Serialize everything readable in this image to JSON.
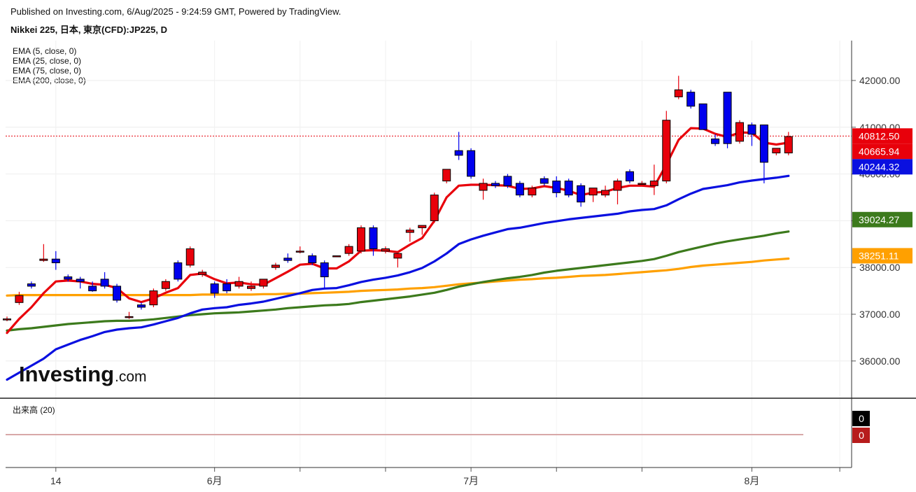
{
  "header": {
    "published": "Published on Investing.com, 6/Aug/2025 - 9:24:59 GMT, Powered by TradingView.",
    "symbol": "Nikkei 225, 日本, 東京(CFD):JP225, D"
  },
  "indicators": {
    "ema5": "EMA (5, close, 0)",
    "ema25": "EMA (25, close, 0)",
    "ema75": "EMA (75, close, 0)",
    "ema200": "EMA (200, close, 0)"
  },
  "volume_label": "出来高 (20)",
  "logo": {
    "main": "Investing",
    "suffix": ".com"
  },
  "colors": {
    "up": "#e8000b",
    "down": "#0000ee",
    "ema5": "#e8000b",
    "ema25": "#0a10e0",
    "ema75": "#3c7a1c",
    "ema200": "#ffa000",
    "last_price_line": "#e8000b"
  },
  "chart_data": {
    "type": "candlestick",
    "y_axis": {
      "ticks": [
        36000,
        37000,
        38000,
        39000,
        40000,
        41000,
        42000
      ],
      "tick_labels": [
        "36000.00",
        "37000.00",
        "38000.00",
        "39000.00",
        "40000.00",
        "41000.00",
        "42000.00"
      ],
      "range": [
        35300,
        42850
      ]
    },
    "x_axis": {
      "tick_labels": [
        {
          "label": "14",
          "index": 4
        },
        {
          "label": "6月",
          "index": 17
        },
        {
          "label": "7月",
          "index": 38
        },
        {
          "label": "8月",
          "index": 61
        }
      ]
    },
    "candles": [
      {
        "o": 36900,
        "h": 36950,
        "l": 36850,
        "c": 36900
      },
      {
        "o": 37250,
        "h": 37480,
        "l": 37200,
        "c": 37400
      },
      {
        "o": 37650,
        "h": 37700,
        "l": 37550,
        "c": 37600
      },
      {
        "o": 38150,
        "h": 38500,
        "l": 38120,
        "c": 38180
      },
      {
        "o": 38180,
        "h": 38350,
        "l": 37950,
        "c": 38100
      },
      {
        "o": 37800,
        "h": 37850,
        "l": 37700,
        "c": 37750
      },
      {
        "o": 37750,
        "h": 37800,
        "l": 37550,
        "c": 37700
      },
      {
        "o": 37600,
        "h": 37700,
        "l": 37480,
        "c": 37500
      },
      {
        "o": 37750,
        "h": 37900,
        "l": 37550,
        "c": 37600
      },
      {
        "o": 37600,
        "h": 37650,
        "l": 37250,
        "c": 37300
      },
      {
        "o": 36950,
        "h": 37050,
        "l": 36900,
        "c": 36950
      },
      {
        "o": 37200,
        "h": 37250,
        "l": 37100,
        "c": 37150
      },
      {
        "o": 37200,
        "h": 37550,
        "l": 37150,
        "c": 37500
      },
      {
        "o": 37550,
        "h": 37750,
        "l": 37500,
        "c": 37700
      },
      {
        "o": 38100,
        "h": 38150,
        "l": 37700,
        "c": 37750
      },
      {
        "o": 38050,
        "h": 38450,
        "l": 38000,
        "c": 38400
      },
      {
        "o": 37850,
        "h": 37950,
        "l": 37800,
        "c": 37900
      },
      {
        "o": 37650,
        "h": 37700,
        "l": 37350,
        "c": 37450
      },
      {
        "o": 37650,
        "h": 37750,
        "l": 37450,
        "c": 37500
      },
      {
        "o": 37600,
        "h": 37800,
        "l": 37550,
        "c": 37700
      },
      {
        "o": 37550,
        "h": 37700,
        "l": 37500,
        "c": 37600
      },
      {
        "o": 37600,
        "h": 37700,
        "l": 37550,
        "c": 37750
      },
      {
        "o": 38000,
        "h": 38100,
        "l": 37950,
        "c": 38050
      },
      {
        "o": 38200,
        "h": 38300,
        "l": 38100,
        "c": 38150
      },
      {
        "o": 38350,
        "h": 38450,
        "l": 38300,
        "c": 38350
      },
      {
        "o": 38250,
        "h": 38300,
        "l": 38050,
        "c": 38100
      },
      {
        "o": 38100,
        "h": 38150,
        "l": 37550,
        "c": 37800
      },
      {
        "o": 38250,
        "h": 38250,
        "l": 38250,
        "c": 38250
      },
      {
        "o": 38300,
        "h": 38500,
        "l": 38250,
        "c": 38450
      },
      {
        "o": 38350,
        "h": 38900,
        "l": 38300,
        "c": 38850
      },
      {
        "o": 38850,
        "h": 38900,
        "l": 38250,
        "c": 38400
      },
      {
        "o": 38350,
        "h": 38450,
        "l": 38300,
        "c": 38400
      },
      {
        "o": 38200,
        "h": 38300,
        "l": 38000,
        "c": 38300
      },
      {
        "o": 38750,
        "h": 38850,
        "l": 38550,
        "c": 38800
      },
      {
        "o": 38850,
        "h": 38900,
        "l": 38700,
        "c": 38900
      },
      {
        "o": 39000,
        "h": 39600,
        "l": 38950,
        "c": 39550
      },
      {
        "o": 39850,
        "h": 40000,
        "l": 39800,
        "c": 40100
      },
      {
        "o": 40500,
        "h": 40900,
        "l": 40300,
        "c": 40400
      },
      {
        "o": 40500,
        "h": 40550,
        "l": 39900,
        "c": 39950
      },
      {
        "o": 39650,
        "h": 39900,
        "l": 39450,
        "c": 39800
      },
      {
        "o": 39800,
        "h": 39850,
        "l": 39700,
        "c": 39750
      },
      {
        "o": 39950,
        "h": 40000,
        "l": 39700,
        "c": 39750
      },
      {
        "o": 39800,
        "h": 39850,
        "l": 39500,
        "c": 39550
      },
      {
        "o": 39550,
        "h": 39750,
        "l": 39500,
        "c": 39700
      },
      {
        "o": 39900,
        "h": 39950,
        "l": 39750,
        "c": 39800
      },
      {
        "o": 39850,
        "h": 39950,
        "l": 39500,
        "c": 39600
      },
      {
        "o": 39850,
        "h": 39900,
        "l": 39500,
        "c": 39550
      },
      {
        "o": 39750,
        "h": 39800,
        "l": 39300,
        "c": 39400
      },
      {
        "o": 39550,
        "h": 39650,
        "l": 39400,
        "c": 39700
      },
      {
        "o": 39550,
        "h": 39750,
        "l": 39500,
        "c": 39650
      },
      {
        "o": 39650,
        "h": 39900,
        "l": 39350,
        "c": 39850
      },
      {
        "o": 40050,
        "h": 40100,
        "l": 39800,
        "c": 39850
      },
      {
        "o": 39800,
        "h": 39850,
        "l": 39750,
        "c": 39800
      },
      {
        "o": 39750,
        "h": 40200,
        "l": 39550,
        "c": 39850
      },
      {
        "o": 39850,
        "h": 41350,
        "l": 39800,
        "c": 41150
      },
      {
        "o": 41650,
        "h": 42100,
        "l": 41600,
        "c": 41800
      },
      {
        "o": 41750,
        "h": 41800,
        "l": 41400,
        "c": 41450
      },
      {
        "o": 41500,
        "h": 41500,
        "l": 40950,
        "c": 40950
      },
      {
        "o": 40750,
        "h": 40850,
        "l": 40600,
        "c": 40650
      },
      {
        "o": 41750,
        "h": 41750,
        "l": 40550,
        "c": 40650
      },
      {
        "o": 40700,
        "h": 41150,
        "l": 40650,
        "c": 41100
      },
      {
        "o": 41050,
        "h": 41100,
        "l": 40600,
        "c": 40850
      },
      {
        "o": 41050,
        "h": 41050,
        "l": 39800,
        "c": 40250
      },
      {
        "o": 40450,
        "h": 40550,
        "l": 40400,
        "c": 40550
      },
      {
        "o": 40450,
        "h": 40900,
        "l": 40400,
        "c": 40800
      }
    ],
    "series": [
      {
        "name": "EMA (5, close, 0)",
        "last": 40665.94,
        "values": [
          36600,
          36900,
          37150,
          37450,
          37700,
          37720,
          37700,
          37650,
          37630,
          37560,
          37340,
          37260,
          37340,
          37460,
          37560,
          37840,
          37870,
          37750,
          37660,
          37680,
          37640,
          37630,
          37770,
          37910,
          38060,
          38080,
          37980,
          37980,
          38130,
          38360,
          38370,
          38360,
          38330,
          38490,
          38630,
          39000,
          39500,
          39750,
          39770,
          39770,
          39760,
          39750,
          39680,
          39690,
          39740,
          39700,
          39640,
          39550,
          39600,
          39620,
          39700,
          39750,
          39750,
          39730,
          40200,
          40730,
          40980,
          40970,
          40860,
          40790,
          40890,
          40880,
          40670,
          40630,
          40670
        ]
      },
      {
        "name": "EMA (25, close, 0)",
        "last": 40244.32,
        "values": [
          35600,
          35750,
          35900,
          36050,
          36250,
          36350,
          36450,
          36530,
          36620,
          36670,
          36700,
          36720,
          36780,
          36850,
          36920,
          37020,
          37100,
          37130,
          37150,
          37200,
          37230,
          37270,
          37330,
          37390,
          37450,
          37520,
          37550,
          37560,
          37620,
          37690,
          37740,
          37780,
          37830,
          37900,
          37990,
          38130,
          38300,
          38500,
          38600,
          38680,
          38750,
          38820,
          38850,
          38900,
          38950,
          38990,
          39030,
          39060,
          39090,
          39120,
          39150,
          39200,
          39230,
          39250,
          39330,
          39460,
          39580,
          39680,
          39720,
          39760,
          39820,
          39860,
          39890,
          39920,
          39960
        ]
      },
      {
        "name": "EMA (75, close, 0)",
        "last": 39024.27,
        "values": [
          36650,
          36680,
          36700,
          36730,
          36760,
          36790,
          36810,
          36830,
          36850,
          36860,
          36860,
          36870,
          36890,
          36920,
          36950,
          36980,
          37000,
          37020,
          37030,
          37040,
          37060,
          37080,
          37100,
          37130,
          37150,
          37170,
          37190,
          37200,
          37220,
          37260,
          37290,
          37320,
          37350,
          37380,
          37420,
          37460,
          37520,
          37590,
          37640,
          37690,
          37730,
          37770,
          37800,
          37840,
          37890,
          37930,
          37960,
          37990,
          38020,
          38050,
          38080,
          38110,
          38140,
          38180,
          38250,
          38330,
          38390,
          38450,
          38510,
          38560,
          38600,
          38640,
          38680,
          38730,
          38770
        ]
      },
      {
        "name": "EMA (200, close, 0)",
        "last": 38251.11,
        "values": [
          37400,
          37410,
          37410,
          37410,
          37410,
          37410,
          37410,
          37410,
          37410,
          37410,
          37410,
          37410,
          37410,
          37410,
          37410,
          37410,
          37420,
          37420,
          37420,
          37420,
          37420,
          37430,
          37430,
          37440,
          37440,
          37450,
          37460,
          37470,
          37480,
          37500,
          37510,
          37520,
          37530,
          37550,
          37560,
          37580,
          37610,
          37640,
          37660,
          37680,
          37700,
          37720,
          37740,
          37750,
          37770,
          37780,
          37800,
          37820,
          37830,
          37840,
          37860,
          37880,
          37900,
          37920,
          37940,
          37970,
          38010,
          38040,
          38060,
          38080,
          38100,
          38120,
          38150,
          38170,
          38190
        ]
      }
    ],
    "last_price": 40812.5,
    "price_tags": [
      {
        "label": "40812.50",
        "value": 40812.5,
        "color": "#e8000b"
      },
      {
        "label": "40665.94",
        "value": 40665.94,
        "color": "#e8000b"
      },
      {
        "label": "40244.32",
        "value": 40244.32,
        "color": "#0a10e0"
      },
      {
        "label": "39024.27",
        "value": 39024.27,
        "color": "#3c7a1c"
      },
      {
        "label": "38251.11",
        "value": 38251.11,
        "color": "#ffa000"
      }
    ],
    "volume": {
      "tags": [
        {
          "label": "0",
          "color": "#000000"
        },
        {
          "label": "0",
          "color": "#b71c1c"
        }
      ]
    }
  }
}
